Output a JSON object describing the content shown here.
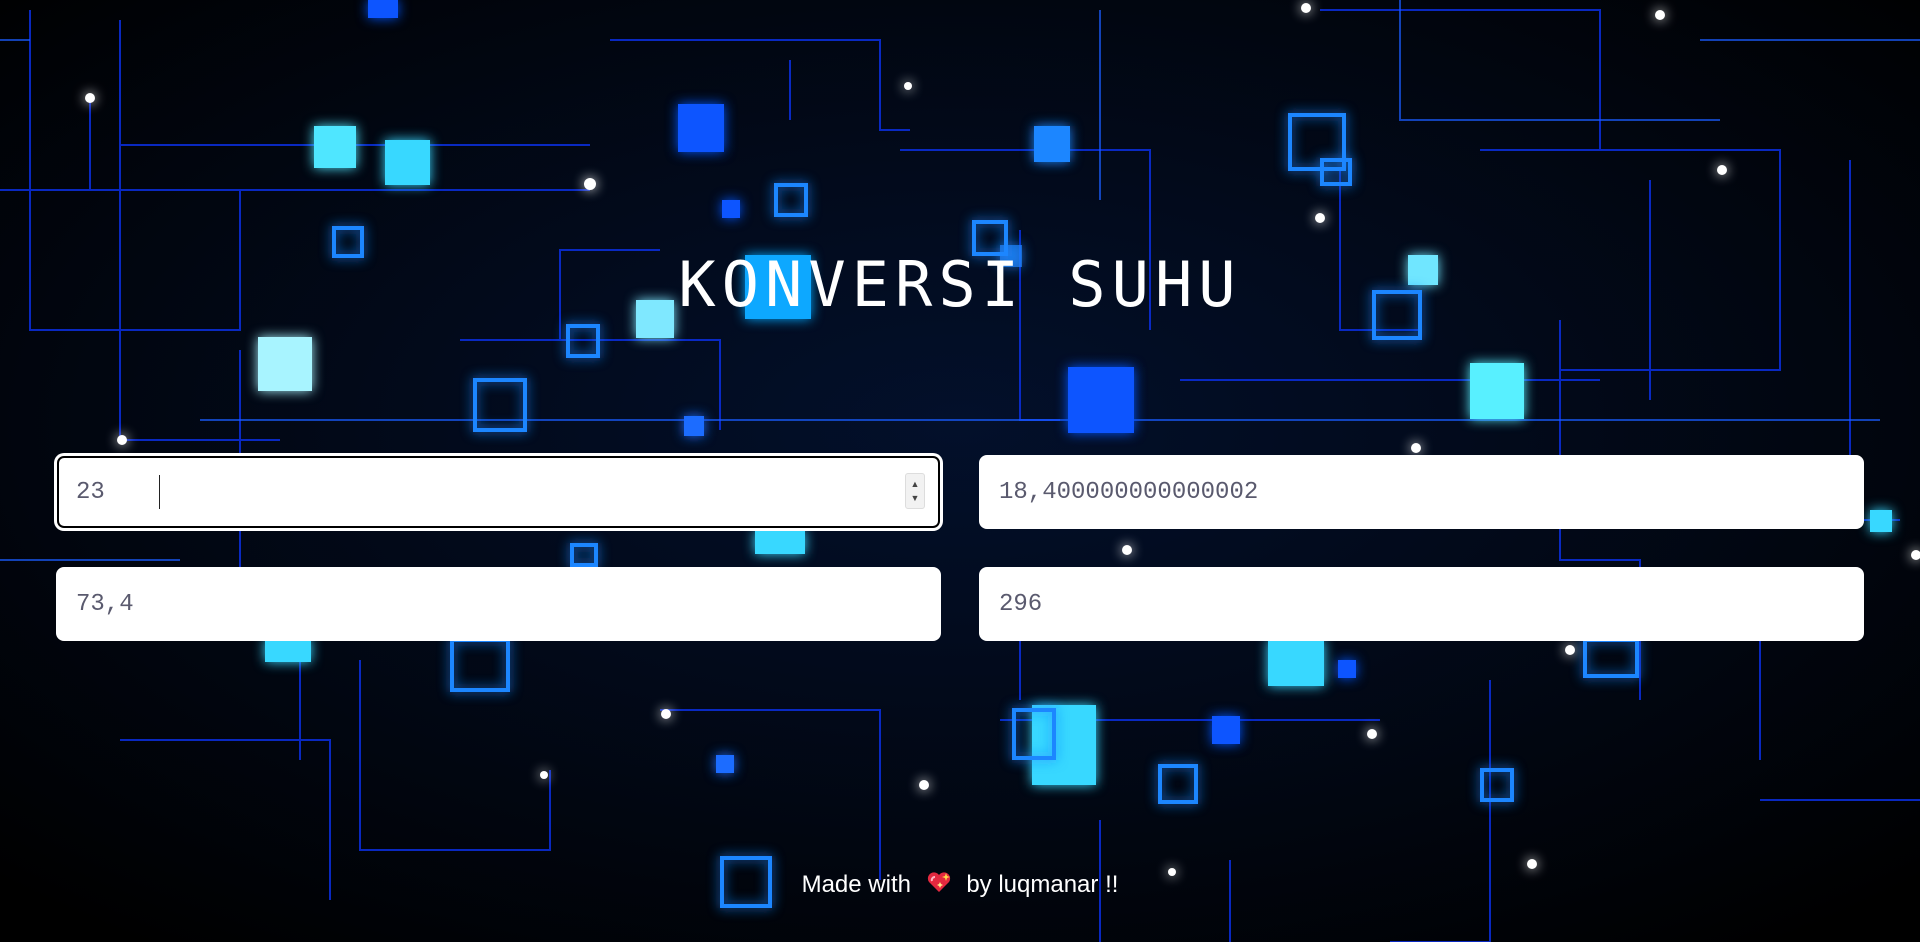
{
  "page": {
    "title": "KONVERSI SUHU"
  },
  "inputs": {
    "celsius": {
      "value": "23"
    },
    "reamur": {
      "value": "18,400000000000002"
    },
    "fahrenheit": {
      "value": "73,4"
    },
    "kelvin": {
      "value": "296"
    }
  },
  "footer": {
    "before": "Made with",
    "heart_icon": "sparkling-heart-icon",
    "after": "by luqmanar !!"
  },
  "colors": {
    "background": "#01040c",
    "circuit_blue": "#0a2cff",
    "glow_cyan": "#38d8ff",
    "field_text": "#5a5a6e"
  }
}
